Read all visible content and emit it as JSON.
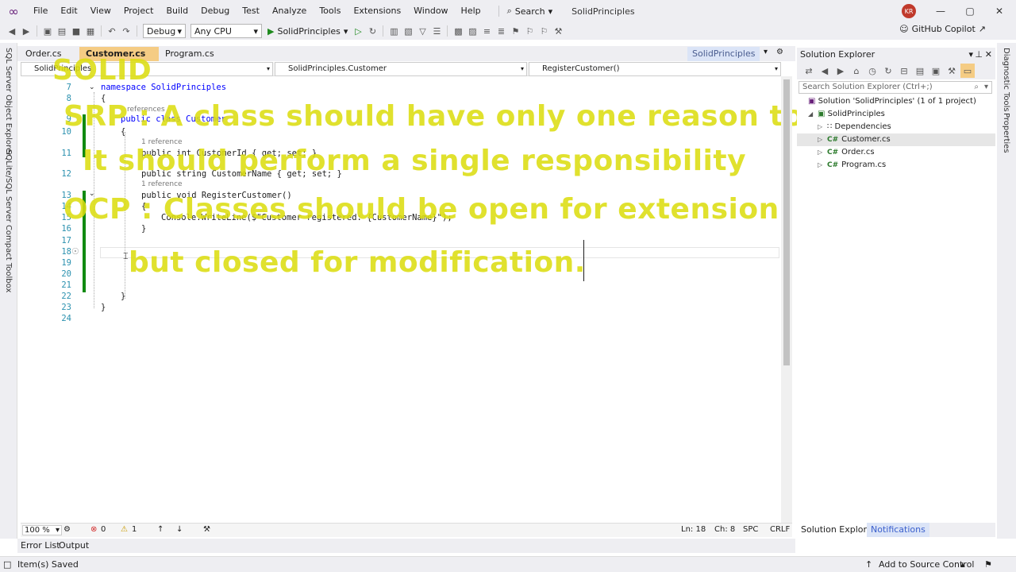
{
  "menubar": {
    "items": [
      "File",
      "Edit",
      "View",
      "Project",
      "Build",
      "Debug",
      "Test",
      "Analyze",
      "Tools",
      "Extensions",
      "Window",
      "Help"
    ],
    "search_label": "Search",
    "window_title": "SolidPrinciples",
    "user_initials": "KR"
  },
  "toolbar": {
    "config": "Debug",
    "platform": "Any CPU",
    "run_target": "SolidPrinciples",
    "copilot": "GitHub Copilot"
  },
  "left_rail": {
    "items": [
      "SQL Server Object Explorer",
      "SQLite/SQL Server Compact Toolbox"
    ]
  },
  "right_rail": {
    "items": [
      "Diagnostic Tools",
      "Properties"
    ]
  },
  "doc_tabs": {
    "tabs": [
      {
        "label": "Order.cs"
      },
      {
        "label": "Customer.cs",
        "pin": "⊕",
        "close": "×"
      },
      {
        "label": "Program.cs"
      }
    ],
    "project_tab": "SolidPrinciples"
  },
  "navbar": {
    "project": "SolidPrinciples",
    "type": "SolidPrinciples.Customer",
    "member": "RegisterCustomer()"
  },
  "code": {
    "line_numbers": [
      "7",
      "8",
      "9",
      "10",
      "11",
      "12",
      "13",
      "14",
      "15",
      "16",
      "17",
      "18",
      "19",
      "20",
      "21",
      "22",
      "23",
      "24"
    ],
    "references": [
      "references",
      "1 reference",
      "1 reference"
    ],
    "line7": "namespace SolidPrinciples",
    "line8": "{",
    "line9": "public class Customer",
    "line10": "{",
    "line11": "public int CustomerId { get; set; }",
    "line12": "public string CustomerName { get; set; }",
    "line13": "public void RegisterCustomer()",
    "line14": "{",
    "line15": "Console.WriteLine($\"Customer registered: {CustomerName}\");",
    "line16": "}",
    "line22": "}",
    "line23": "}"
  },
  "overlay": {
    "title": "SOLID",
    "srp_line1": "SRP : A class should have only one reason to change",
    "srp_line2": "It should perform a single responsibility",
    "ocp_line1": "OCP : Classes should be open for extension",
    "ocp_line2": "but closed for modification.",
    "color": "#dcde12"
  },
  "editor_status": {
    "zoom": "100 %",
    "errors": "0",
    "warnings": "1",
    "ln": "Ln: 18",
    "ch": "Ch: 8",
    "spc": "SPC",
    "crlf": "CRLF"
  },
  "bottom_tabs": [
    "Error List",
    "Output"
  ],
  "statusbar": {
    "message": "Item(s) Saved",
    "source_control": "Add to Source Control"
  },
  "solution_explorer": {
    "title": "Solution Explorer",
    "search_placeholder": "Search Solution Explorer (Ctrl+;)",
    "solution": "Solution 'SolidPrinciples' (1 of 1 project)",
    "project": "SolidPrinciples",
    "dependencies": "Dependencies",
    "files": [
      "Customer.cs",
      "Order.cs",
      "Program.cs"
    ],
    "file_icon": "C#",
    "tabs": [
      "Solution Explorer",
      "Notifications"
    ]
  }
}
